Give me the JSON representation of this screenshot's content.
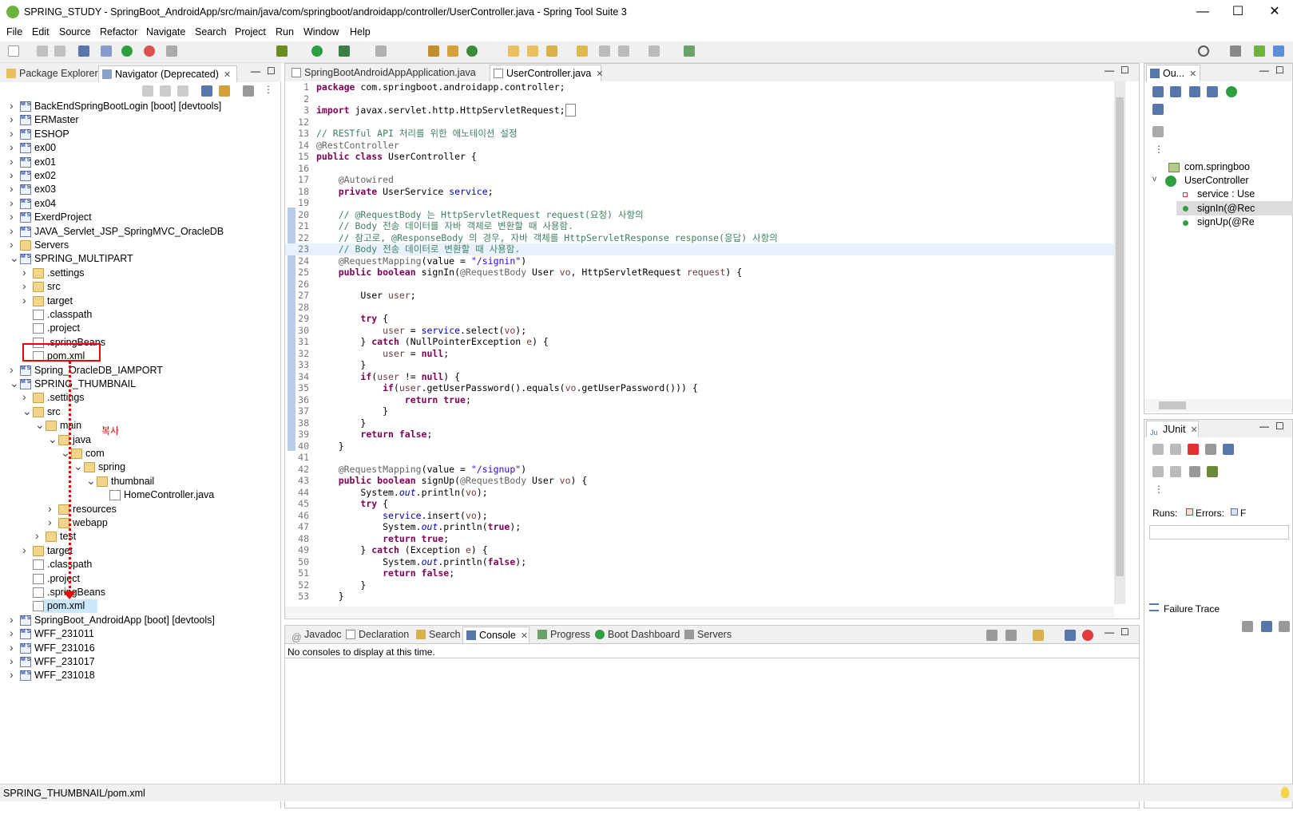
{
  "window": {
    "title": "SPRING_STUDY - SpringBoot_AndroidApp/src/main/java/com/springboot/androidapp/controller/UserController.java - Spring Tool Suite 3",
    "minimize": "—",
    "maximize": "☐",
    "close": "✕"
  },
  "menu": [
    "File",
    "Edit",
    "Source",
    "Refactor",
    "Navigate",
    "Search",
    "Project",
    "Run",
    "Window",
    "Help"
  ],
  "left_tabs": {
    "package_explorer": "Package Explorer",
    "navigator": "Navigator (Deprecated)"
  },
  "tree": [
    {
      "label": "BackEndSpringBootLogin [boot] [devtools]",
      "depth": 0,
      "type": "proj",
      "chev": ">"
    },
    {
      "label": "ERMaster",
      "depth": 0,
      "type": "proj",
      "chev": ">"
    },
    {
      "label": "ESHOP",
      "depth": 0,
      "type": "proj",
      "chev": ">"
    },
    {
      "label": "ex00",
      "depth": 0,
      "type": "proj",
      "chev": ">"
    },
    {
      "label": "ex01",
      "depth": 0,
      "type": "proj",
      "chev": ">"
    },
    {
      "label": "ex02",
      "depth": 0,
      "type": "proj",
      "chev": ">"
    },
    {
      "label": "ex03",
      "depth": 0,
      "type": "proj",
      "chev": ">"
    },
    {
      "label": "ex04",
      "depth": 0,
      "type": "proj",
      "chev": ">"
    },
    {
      "label": "ExerdProject",
      "depth": 0,
      "type": "proj",
      "chev": ">"
    },
    {
      "label": "JAVA_Servlet_JSP_SpringMVC_OracleDB",
      "depth": 0,
      "type": "proj",
      "chev": ">"
    },
    {
      "label": "Servers",
      "depth": 0,
      "type": "fold",
      "chev": ">"
    },
    {
      "label": "SPRING_MULTIPART",
      "depth": 0,
      "type": "proj",
      "chev": "v"
    },
    {
      "label": ".settings",
      "depth": 1,
      "type": "fold",
      "chev": ">"
    },
    {
      "label": "src",
      "depth": 1,
      "type": "fold",
      "chev": ">"
    },
    {
      "label": "target",
      "depth": 1,
      "type": "fold",
      "chev": ">"
    },
    {
      "label": ".classpath",
      "depth": 1,
      "type": "file",
      "chev": ""
    },
    {
      "label": ".project",
      "depth": 1,
      "type": "file",
      "chev": ""
    },
    {
      "label": ".springBeans",
      "depth": 1,
      "type": "file",
      "chev": ""
    },
    {
      "label": "pom.xml",
      "depth": 1,
      "type": "file",
      "chev": ""
    },
    {
      "label": "Spring_OracleDB_IAMPORT",
      "depth": 0,
      "type": "proj",
      "chev": ">"
    },
    {
      "label": "SPRING_THUMBNAIL",
      "depth": 0,
      "type": "proj",
      "chev": "v"
    },
    {
      "label": ".settings",
      "depth": 1,
      "type": "fold",
      "chev": ">"
    },
    {
      "label": "src",
      "depth": 1,
      "type": "fold",
      "chev": "v"
    },
    {
      "label": "main",
      "depth": 2,
      "type": "fold",
      "chev": "v"
    },
    {
      "label": "java",
      "depth": 3,
      "type": "fold",
      "chev": "v"
    },
    {
      "label": "com",
      "depth": 4,
      "type": "fold",
      "chev": "v"
    },
    {
      "label": "spring",
      "depth": 5,
      "type": "fold",
      "chev": "v"
    },
    {
      "label": "thumbnail",
      "depth": 6,
      "type": "fold",
      "chev": "v"
    },
    {
      "label": "HomeController.java",
      "depth": 7,
      "type": "file",
      "chev": ""
    },
    {
      "label": "resources",
      "depth": 3,
      "type": "fold",
      "chev": ">"
    },
    {
      "label": "webapp",
      "depth": 3,
      "type": "fold",
      "chev": ">"
    },
    {
      "label": "test",
      "depth": 2,
      "type": "fold",
      "chev": ">"
    },
    {
      "label": "target",
      "depth": 1,
      "type": "fold",
      "chev": ">"
    },
    {
      "label": ".classpath",
      "depth": 1,
      "type": "file",
      "chev": ""
    },
    {
      "label": ".project",
      "depth": 1,
      "type": "file",
      "chev": ""
    },
    {
      "label": ".springBeans",
      "depth": 1,
      "type": "file",
      "chev": ""
    },
    {
      "label": "pom.xml",
      "depth": 1,
      "type": "file",
      "chev": "",
      "selected": true
    },
    {
      "label": "SpringBoot_AndroidApp [boot] [devtools]",
      "depth": 0,
      "type": "proj",
      "chev": ">"
    },
    {
      "label": "WFF_231011",
      "depth": 0,
      "type": "proj",
      "chev": ">"
    },
    {
      "label": "WFF_231016",
      "depth": 0,
      "type": "proj",
      "chev": ">"
    },
    {
      "label": "WFF_231017",
      "depth": 0,
      "type": "proj",
      "chev": ">"
    },
    {
      "label": "WFF_231018",
      "depth": 0,
      "type": "proj",
      "chev": ">"
    }
  ],
  "annotation": {
    "copy_label": "복사"
  },
  "editor_tabs": {
    "tab1": "SpringBootAndroidAppApplication.java",
    "tab2": "UserController.java"
  },
  "code": [
    {
      "n": "1",
      "html": "<span class='kw'>package</span> com.springboot.androidapp.controller;"
    },
    {
      "n": "2",
      "html": ""
    },
    {
      "n": "3",
      "html": "<span class='kw'>import</span> javax.servlet.http.HttpServletRequest;<span style='border:1px solid #888;padding:0 2px'> </span>"
    },
    {
      "n": "12",
      "html": ""
    },
    {
      "n": "13",
      "html": "<span class='cm'>// RESTful API 처리를 위한 애노테이션 설정</span>"
    },
    {
      "n": "14",
      "html": "<span class='an'>@RestController</span>"
    },
    {
      "n": "15",
      "html": "<span class='kw'>public class</span> UserController {"
    },
    {
      "n": "16",
      "html": ""
    },
    {
      "n": "17",
      "html": "    <span class='an'>@Autowired</span>"
    },
    {
      "n": "18",
      "html": "    <span class='kw'>private</span> UserService <span class='fd'>service</span>;"
    },
    {
      "n": "19",
      "html": ""
    },
    {
      "n": "20",
      "html": "    <span class='cm'>// @RequestBody 는 HttpServletRequest request(요청) 사항의</span>"
    },
    {
      "n": "21",
      "html": "    <span class='cm'>// Body 전송 데이터를 자바 객체로 변환할 때 사용함.</span>"
    },
    {
      "n": "22",
      "html": "    <span class='cm'>// 참고로, @ResponseBody 의 경우, 자바 객체를 HttpServletResponse response(응답) 사항의</span>"
    },
    {
      "n": "23",
      "html": "    <span class='cm'>// Body 전송 데이터로 변환할 때 사용함.</span>"
    },
    {
      "n": "24",
      "html": "    <span class='an'>@RequestMapping</span>(value = <span class='st'>\"/signin\"</span>)"
    },
    {
      "n": "25",
      "html": "    <span class='kw'>public boolean</span> signIn(<span class='an'>@RequestBody</span> User <span class='lv'>vo</span>, HttpServletRequest <span class='lv'>request</span>) {"
    },
    {
      "n": "26",
      "html": ""
    },
    {
      "n": "27",
      "html": "        User <span class='lv'>user</span>;"
    },
    {
      "n": "28",
      "html": ""
    },
    {
      "n": "29",
      "html": "        <span class='kw'>try</span> {"
    },
    {
      "n": "30",
      "html": "            <span class='lv'>user</span> = <span class='fd'>service</span>.select(<span class='lv'>vo</span>);"
    },
    {
      "n": "31",
      "html": "        } <span class='kw'>catch</span> (NullPointerException <span class='lv'>e</span>) {"
    },
    {
      "n": "32",
      "html": "            <span class='lv'>user</span> = <span class='kw'>null</span>;"
    },
    {
      "n": "33",
      "html": "        }"
    },
    {
      "n": "34",
      "html": "        <span class='kw'>if</span>(<span class='lv'>user</span> != <span class='kw'>null</span>) {"
    },
    {
      "n": "35",
      "html": "            <span class='kw'>if</span>(<span class='lv'>user</span>.getUserPassword().equals(<span class='lv'>vo</span>.getUserPassword())) {"
    },
    {
      "n": "36",
      "html": "                <span class='kw'>return true</span>;"
    },
    {
      "n": "37",
      "html": "            }"
    },
    {
      "n": "38",
      "html": "        }"
    },
    {
      "n": "39",
      "html": "        <span class='kw'>return false</span>;"
    },
    {
      "n": "40",
      "html": "    }"
    },
    {
      "n": "41",
      "html": ""
    },
    {
      "n": "42",
      "html": "    <span class='an'>@RequestMapping</span>(value = <span class='st'>\"/signup\"</span>)"
    },
    {
      "n": "43",
      "html": "    <span class='kw'>public boolean</span> signUp(<span class='an'>@RequestBody</span> User <span class='lv'>vo</span>) {"
    },
    {
      "n": "44",
      "html": "        System.<span class='sf'>out</span>.println(<span class='lv'>vo</span>);"
    },
    {
      "n": "45",
      "html": "        <span class='kw'>try</span> {"
    },
    {
      "n": "46",
      "html": "            <span class='fd'>service</span>.insert(<span class='lv'>vo</span>);"
    },
    {
      "n": "47",
      "html": "            System.<span class='sf'>out</span>.println(<span class='kw'>true</span>);"
    },
    {
      "n": "48",
      "html": "            <span class='kw'>return true</span>;"
    },
    {
      "n": "49",
      "html": "        } <span class='kw'>catch</span> (Exception <span class='lv'>e</span>) {"
    },
    {
      "n": "50",
      "html": "            System.<span class='sf'>out</span>.println(<span class='kw'>false</span>);"
    },
    {
      "n": "51",
      "html": "            <span class='kw'>return false</span>;"
    },
    {
      "n": "52",
      "html": "        }"
    },
    {
      "n": "53",
      "html": "    }"
    }
  ],
  "console_tabs": [
    "Javadoc",
    "Declaration",
    "Search",
    "Console",
    "Progress",
    "Boot Dashboard",
    "Servers"
  ],
  "console_message": "No consoles to display at this time.",
  "outline": {
    "tab": "Ou...",
    "package": "com.springboo",
    "class": "UserController",
    "members": [
      "service : Use",
      "signIn(@Rec",
      "signUp(@Re"
    ]
  },
  "junit": {
    "tab": "JUnit",
    "runs_label": "Runs:",
    "errors_label": "Errors:",
    "failures_label": "F",
    "failure_trace": "Failure Trace"
  },
  "status": {
    "path": "SPRING_THUMBNAIL/pom.xml"
  },
  "colors": {
    "accent": "#6db33f",
    "annotation_red": "#ee0000",
    "selection": "#cce8ff"
  }
}
